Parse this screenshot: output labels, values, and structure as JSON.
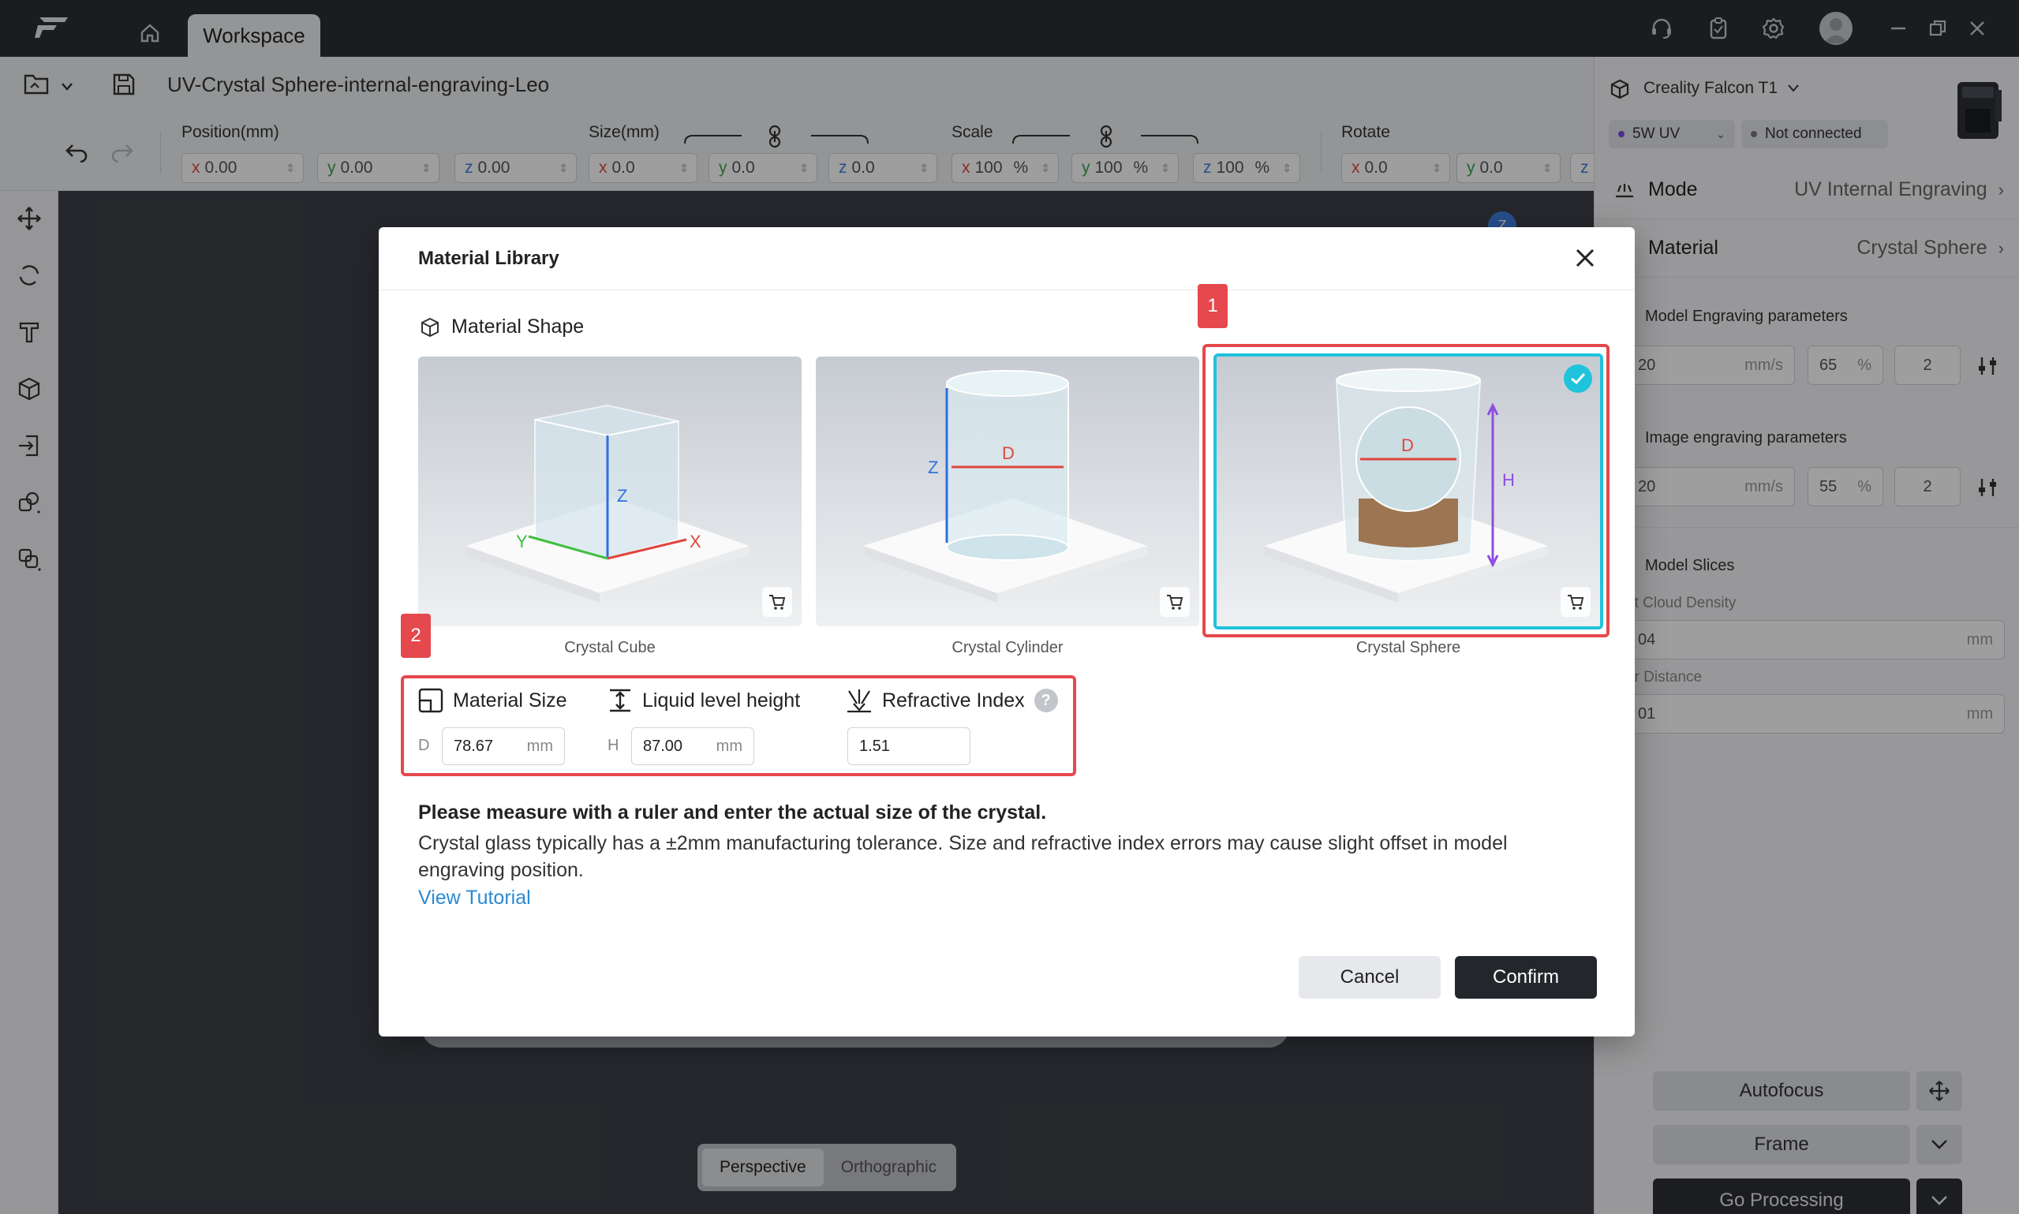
{
  "titlebar": {
    "tab": "Workspace"
  },
  "filebar": {
    "filename": "UV-Crystal Sphere-internal-engraving-Leo"
  },
  "transform": {
    "position_label": "Position(mm)",
    "size_label": "Size(mm)",
    "scale_label": "Scale",
    "rotate_label": "Rotate",
    "position": {
      "x": "0.00",
      "y": "0.00",
      "z": "0.00"
    },
    "size": {
      "x": "0.0",
      "y": "0.0",
      "z": "0.0"
    },
    "scale": {
      "x": "100",
      "y": "100",
      "z": "100",
      "unit": "%"
    },
    "rotate": {
      "x": "0.0",
      "y": "0.0",
      "z": "z"
    },
    "axis": {
      "x": "x",
      "y": "y",
      "z": "z"
    }
  },
  "viewport": {
    "perspective": "Perspective",
    "orthographic": "Orthographic",
    "axis_badge": "Z"
  },
  "device": {
    "name": "Creality Falcon T1",
    "laser": "5W UV",
    "status": "Not connected"
  },
  "rightpanel": {
    "mode_label": "Mode",
    "mode_value": "UV Internal Engraving",
    "material_label": "Material",
    "material_value": "Crystal Sphere",
    "model_engraving_label": "Model Engraving parameters",
    "model_params": {
      "speed": "20",
      "speed_unit": "mm/s",
      "power": "65",
      "power_unit": "%",
      "passes": "2"
    },
    "image_engraving_label": "Image engraving parameters",
    "image_params": {
      "speed": "20",
      "speed_unit": "mm/s",
      "power": "55",
      "power_unit": "%",
      "passes": "2"
    },
    "model_slices_label": "Model Slices",
    "point_cloud_label": "nt Cloud Density",
    "point_cloud_value": "04",
    "point_cloud_unit": "mm",
    "layer_distance_label": "er Distance",
    "layer_distance_value": "01",
    "layer_distance_unit": "mm",
    "autofocus": "Autofocus",
    "frame": "Frame",
    "go_processing": "Go Processing"
  },
  "modal": {
    "title": "Material Library",
    "shape_section": "Material Shape",
    "cards": [
      {
        "label": "Crystal Cube",
        "axis1": "Z",
        "axis2": "Y",
        "axis3": "X"
      },
      {
        "label": "Crystal Cylinder",
        "axis1": "Z",
        "axis2": "D"
      },
      {
        "label": "Crystal Sphere",
        "axis1": "D",
        "axis2": "H"
      }
    ],
    "badge1": "1",
    "badge2": "2",
    "material_size_label": "Material Size",
    "liquid_label": "Liquid level height",
    "refractive_label": "Refractive Index",
    "help": "?",
    "d_prefix": "D",
    "d_value": "78.67",
    "d_unit": "mm",
    "h_prefix": "H",
    "h_value": "87.00",
    "h_unit": "mm",
    "ri_value": "1.51",
    "notice_bold": "Please measure with a ruler and enter the actual size of the crystal.",
    "notice_text": "Crystal glass typically has a ±2mm manufacturing tolerance. Size and refractive index errors may cause slight offset in model engraving position.",
    "tutorial": "View Tutorial",
    "cancel": "Cancel",
    "confirm": "Confirm"
  },
  "colors": {
    "accent_cyan": "#1fc3dc",
    "highlight_red": "#e5484d",
    "link": "#2a8ad4",
    "dark_button": "#23262b"
  }
}
